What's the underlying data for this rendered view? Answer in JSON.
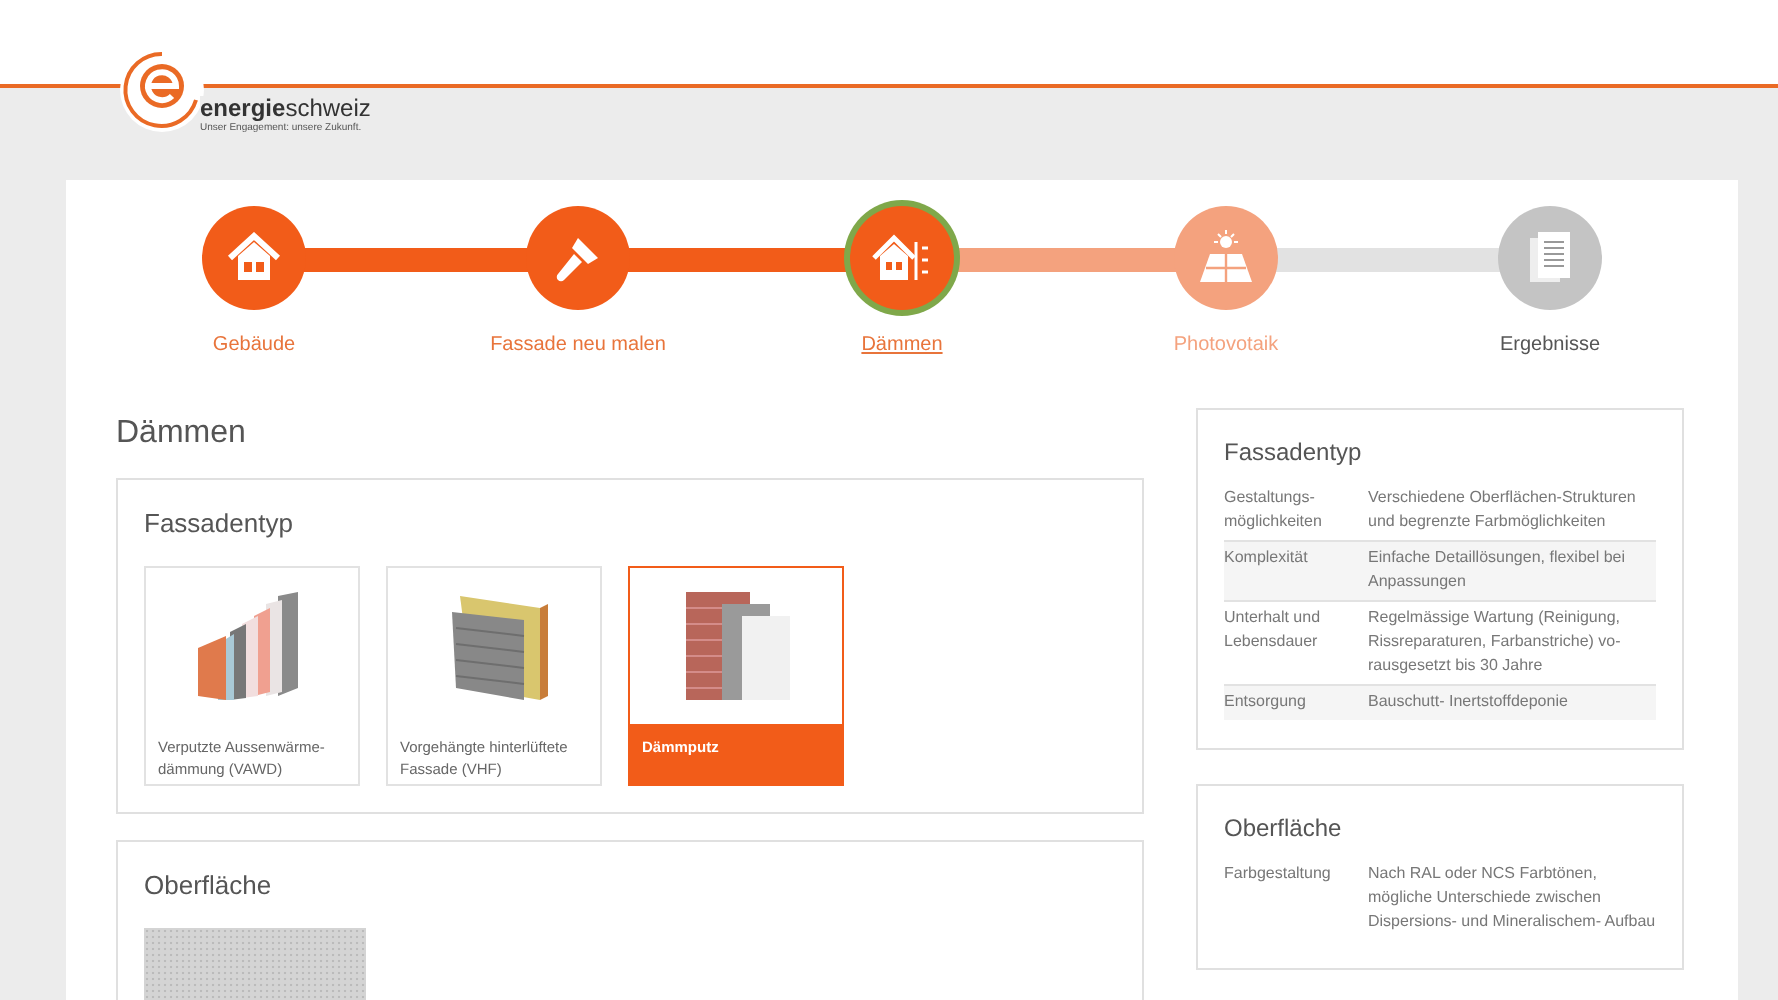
{
  "logo": {
    "wordmark_bold": "energie",
    "wordmark": "schweiz",
    "tagline": "Unser Engagement: unsere Zukunft."
  },
  "steps": [
    {
      "label": "Gebäude",
      "kind": "house",
      "done": true,
      "available": true,
      "selected": false
    },
    {
      "label": "Fassade neu malen",
      "kind": "brush",
      "done": true,
      "available": true,
      "selected": false
    },
    {
      "label": "Dämmen",
      "kind": "insulation",
      "done": false,
      "available": true,
      "selected": true
    },
    {
      "label": "Photovotaik",
      "kind": "solar",
      "done": false,
      "available": true,
      "selected": false
    },
    {
      "label": "Ergebnisse",
      "kind": "documents",
      "done": false,
      "available": false,
      "selected": false
    }
  ],
  "page_title": "Dämmen",
  "sections": [
    {
      "title": "Fassadentyp",
      "options": [
        {
          "label": "Verputzte Aussenwärme-dämmung (VAWD)",
          "kind": "vawd",
          "selected": false
        },
        {
          "label": "Vorgehängte hinterlüftete Fassade (VHF)",
          "kind": "vhf",
          "selected": false
        },
        {
          "label": "Dämmputz",
          "kind": "plaster",
          "selected": true
        }
      ]
    },
    {
      "title": "Oberfläche",
      "options": [
        {
          "kind": "texture",
          "selected": false
        }
      ]
    }
  ],
  "info_cards": [
    {
      "title": "Fassadentyp",
      "rows": [
        {
          "label": "Gestaltungs-möglichkeiten",
          "value": "Verschiedene Oberflächen-Strukturen und begrenzte Farbmöglichkeiten"
        },
        {
          "label": "Komplexität",
          "value": "Einfache Detaillösungen, flexibel bei Anpassungen"
        },
        {
          "label": "Unterhalt und Lebensdauer",
          "value": "Regelmässige Wartung (Reinigung, Rissreparaturen, Farbanstriche) vo-rausgesetzt bis 30 Jahre"
        },
        {
          "label": "Entsorgung",
          "value": "Bauschutt- Inertstoffdeponie"
        }
      ]
    },
    {
      "title": "Oberfläche",
      "rows": [
        {
          "label": "Farbgestaltung",
          "value": "Nach RAL oder NCS Farbtönen, mögliche Unterschiede zwischen Dispersions- und Mineralischem- Aufbau"
        }
      ]
    }
  ]
}
